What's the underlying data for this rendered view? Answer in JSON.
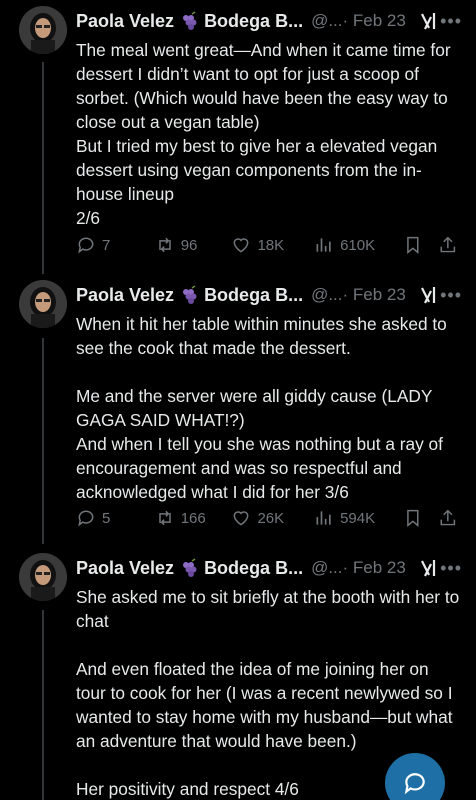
{
  "colors": {
    "background": "#000000",
    "text": "#e7e9ea",
    "muted": "#71767b",
    "fab": "#1d6fa5"
  },
  "tweets": [
    {
      "name": "Paola Velez",
      "affiliation": "Bodega B...",
      "handle": "@...",
      "date": "· Feb 23",
      "text": "The meal went great—And when it came time for dessert I didn’t want to opt for just a scoop of sorbet. (Which would have been the easy way to close out a vegan table)\nBut I tried my best to give her a elevated vegan dessert using vegan components from the in-house lineup\n2/6",
      "replies": "7",
      "reposts": "96",
      "likes": "18K",
      "views": "610K"
    },
    {
      "name": "Paola Velez",
      "affiliation": "Bodega B...",
      "handle": "@...",
      "date": "· Feb 23",
      "text": "When it hit her table within minutes she asked to see the cook that made the dessert.\n\nMe and the server were all giddy cause (LADY GAGA SAID WHAT!?)\nAnd when I tell you she was nothing but a ray of encouragement and was so respectful and acknowledged what I did for her 3/6",
      "replies": "5",
      "reposts": "166",
      "likes": "26K",
      "views": "594K"
    },
    {
      "name": "Paola Velez",
      "affiliation": "Bodega B...",
      "handle": "@...",
      "date": "· Feb 23",
      "text": "She asked me to sit briefly at the booth with her to chat\n\nAnd even floated the idea of me joining her on tour to cook for her (I was a recent newlywed so I wanted to stay home with my husband—but what an adventure that would have been.)\n\nHer positivity and respect 4/6"
    }
  ]
}
